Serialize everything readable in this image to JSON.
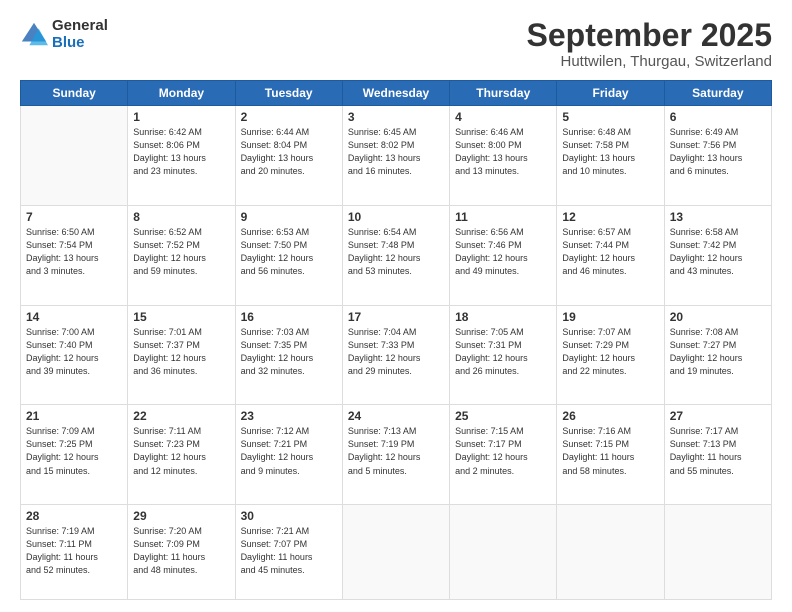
{
  "logo": {
    "general": "General",
    "blue": "Blue"
  },
  "title": "September 2025",
  "subtitle": "Huttwilen, Thurgau, Switzerland",
  "days_of_week": [
    "Sunday",
    "Monday",
    "Tuesday",
    "Wednesday",
    "Thursday",
    "Friday",
    "Saturday"
  ],
  "weeks": [
    [
      {
        "day": "",
        "info": ""
      },
      {
        "day": "1",
        "info": "Sunrise: 6:42 AM\nSunset: 8:06 PM\nDaylight: 13 hours\nand 23 minutes."
      },
      {
        "day": "2",
        "info": "Sunrise: 6:44 AM\nSunset: 8:04 PM\nDaylight: 13 hours\nand 20 minutes."
      },
      {
        "day": "3",
        "info": "Sunrise: 6:45 AM\nSunset: 8:02 PM\nDaylight: 13 hours\nand 16 minutes."
      },
      {
        "day": "4",
        "info": "Sunrise: 6:46 AM\nSunset: 8:00 PM\nDaylight: 13 hours\nand 13 minutes."
      },
      {
        "day": "5",
        "info": "Sunrise: 6:48 AM\nSunset: 7:58 PM\nDaylight: 13 hours\nand 10 minutes."
      },
      {
        "day": "6",
        "info": "Sunrise: 6:49 AM\nSunset: 7:56 PM\nDaylight: 13 hours\nand 6 minutes."
      }
    ],
    [
      {
        "day": "7",
        "info": "Sunrise: 6:50 AM\nSunset: 7:54 PM\nDaylight: 13 hours\nand 3 minutes."
      },
      {
        "day": "8",
        "info": "Sunrise: 6:52 AM\nSunset: 7:52 PM\nDaylight: 12 hours\nand 59 minutes."
      },
      {
        "day": "9",
        "info": "Sunrise: 6:53 AM\nSunset: 7:50 PM\nDaylight: 12 hours\nand 56 minutes."
      },
      {
        "day": "10",
        "info": "Sunrise: 6:54 AM\nSunset: 7:48 PM\nDaylight: 12 hours\nand 53 minutes."
      },
      {
        "day": "11",
        "info": "Sunrise: 6:56 AM\nSunset: 7:46 PM\nDaylight: 12 hours\nand 49 minutes."
      },
      {
        "day": "12",
        "info": "Sunrise: 6:57 AM\nSunset: 7:44 PM\nDaylight: 12 hours\nand 46 minutes."
      },
      {
        "day": "13",
        "info": "Sunrise: 6:58 AM\nSunset: 7:42 PM\nDaylight: 12 hours\nand 43 minutes."
      }
    ],
    [
      {
        "day": "14",
        "info": "Sunrise: 7:00 AM\nSunset: 7:40 PM\nDaylight: 12 hours\nand 39 minutes."
      },
      {
        "day": "15",
        "info": "Sunrise: 7:01 AM\nSunset: 7:37 PM\nDaylight: 12 hours\nand 36 minutes."
      },
      {
        "day": "16",
        "info": "Sunrise: 7:03 AM\nSunset: 7:35 PM\nDaylight: 12 hours\nand 32 minutes."
      },
      {
        "day": "17",
        "info": "Sunrise: 7:04 AM\nSunset: 7:33 PM\nDaylight: 12 hours\nand 29 minutes."
      },
      {
        "day": "18",
        "info": "Sunrise: 7:05 AM\nSunset: 7:31 PM\nDaylight: 12 hours\nand 26 minutes."
      },
      {
        "day": "19",
        "info": "Sunrise: 7:07 AM\nSunset: 7:29 PM\nDaylight: 12 hours\nand 22 minutes."
      },
      {
        "day": "20",
        "info": "Sunrise: 7:08 AM\nSunset: 7:27 PM\nDaylight: 12 hours\nand 19 minutes."
      }
    ],
    [
      {
        "day": "21",
        "info": "Sunrise: 7:09 AM\nSunset: 7:25 PM\nDaylight: 12 hours\nand 15 minutes."
      },
      {
        "day": "22",
        "info": "Sunrise: 7:11 AM\nSunset: 7:23 PM\nDaylight: 12 hours\nand 12 minutes."
      },
      {
        "day": "23",
        "info": "Sunrise: 7:12 AM\nSunset: 7:21 PM\nDaylight: 12 hours\nand 9 minutes."
      },
      {
        "day": "24",
        "info": "Sunrise: 7:13 AM\nSunset: 7:19 PM\nDaylight: 12 hours\nand 5 minutes."
      },
      {
        "day": "25",
        "info": "Sunrise: 7:15 AM\nSunset: 7:17 PM\nDaylight: 12 hours\nand 2 minutes."
      },
      {
        "day": "26",
        "info": "Sunrise: 7:16 AM\nSunset: 7:15 PM\nDaylight: 11 hours\nand 58 minutes."
      },
      {
        "day": "27",
        "info": "Sunrise: 7:17 AM\nSunset: 7:13 PM\nDaylight: 11 hours\nand 55 minutes."
      }
    ],
    [
      {
        "day": "28",
        "info": "Sunrise: 7:19 AM\nSunset: 7:11 PM\nDaylight: 11 hours\nand 52 minutes."
      },
      {
        "day": "29",
        "info": "Sunrise: 7:20 AM\nSunset: 7:09 PM\nDaylight: 11 hours\nand 48 minutes."
      },
      {
        "day": "30",
        "info": "Sunrise: 7:21 AM\nSunset: 7:07 PM\nDaylight: 11 hours\nand 45 minutes."
      },
      {
        "day": "",
        "info": ""
      },
      {
        "day": "",
        "info": ""
      },
      {
        "day": "",
        "info": ""
      },
      {
        "day": "",
        "info": ""
      }
    ]
  ]
}
